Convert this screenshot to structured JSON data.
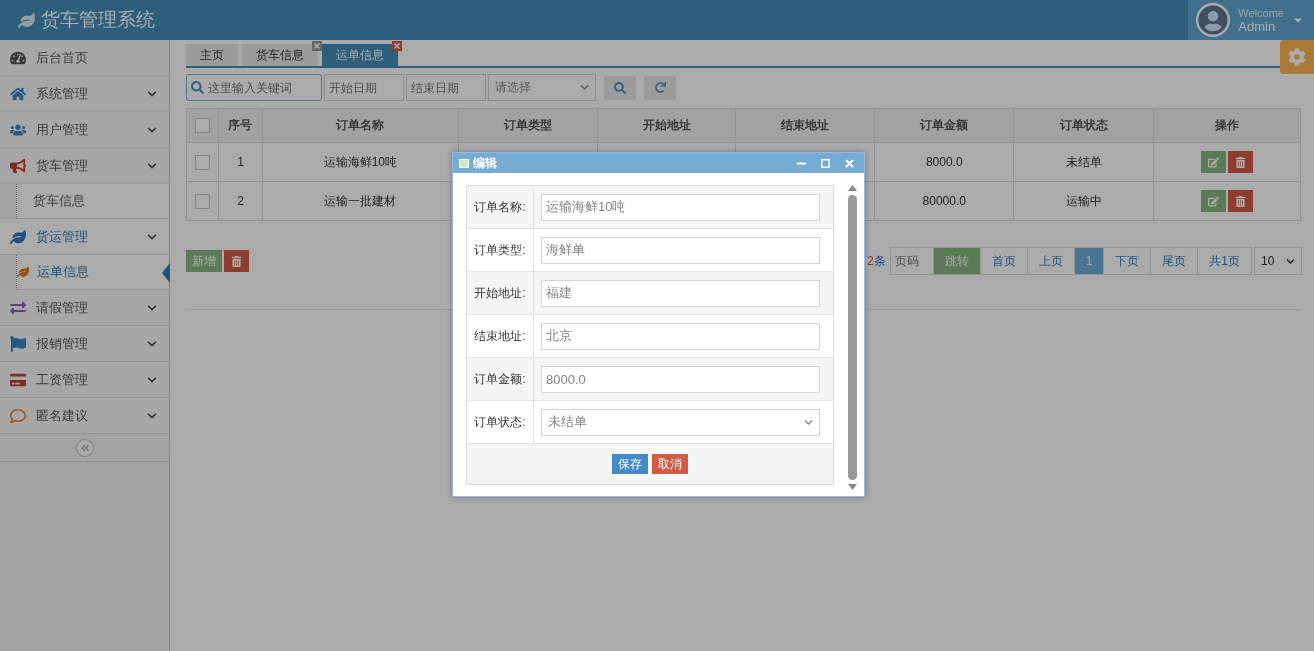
{
  "header": {
    "title": "货车管理系统",
    "welcome": "Welcome",
    "user": "Admin"
  },
  "sidebar": {
    "items": [
      {
        "kind": "link",
        "label": "后台首页",
        "selected": false
      },
      {
        "kind": "group",
        "label": "系统管理",
        "selected": false
      },
      {
        "kind": "group",
        "label": "用户管理",
        "selected": false
      },
      {
        "kind": "group",
        "label": "货车管理",
        "selected": false,
        "children": [
          {
            "label": "货车信息",
            "selected": false
          }
        ]
      },
      {
        "kind": "group",
        "label": "货运管理",
        "selected": true,
        "children": [
          {
            "label": "运单信息",
            "selected": true
          }
        ]
      },
      {
        "kind": "group",
        "label": "请假管理",
        "selected": false
      },
      {
        "kind": "group",
        "label": "报销管理",
        "selected": false
      },
      {
        "kind": "group",
        "label": "工资管理",
        "selected": false
      },
      {
        "kind": "group",
        "label": "匿名建议",
        "selected": false
      }
    ]
  },
  "tabs": [
    {
      "label": "主页",
      "selected": false,
      "closable": false
    },
    {
      "label": "货车信息",
      "selected": false,
      "closable": true
    },
    {
      "label": "运单信息",
      "selected": true,
      "closable": true
    }
  ],
  "toolbar": {
    "keyword": {
      "placeholder": "这里输入关键词"
    },
    "start_date": {
      "placeholder": "开始日期"
    },
    "end_date": {
      "placeholder": "结束日期"
    },
    "status": {
      "placeholder": "请选择"
    }
  },
  "table": {
    "all_checked": false,
    "columns": [
      "序号",
      "订单名称",
      "订单类型",
      "开始地址",
      "结束地址",
      "订单金额",
      "订单状态",
      "操作"
    ],
    "rows": [
      {
        "checked": false,
        "no": "1",
        "name": "运输海鲜10吨",
        "amount": "8000.0",
        "status": "未结单"
      },
      {
        "checked": false,
        "no": "2",
        "name": "运输一批建材",
        "amount": "80000.0",
        "status": "运输中"
      }
    ]
  },
  "actions": {
    "add": "新增"
  },
  "pagination": {
    "total_count": "2",
    "total_unit": "条",
    "page_placeholder": "页码",
    "jump": "跳转",
    "first": "首页",
    "prev": "上页",
    "pages": [
      {
        "label": "1",
        "selected": true
      }
    ],
    "next": "下页",
    "last": "尾页",
    "total_pages": "共1页",
    "page_size": "10"
  },
  "dialog": {
    "title": "编辑",
    "fields": [
      {
        "kind": "text",
        "label": "订单名称:",
        "value": "运输海鲜10吨"
      },
      {
        "kind": "text",
        "label": "订单类型:",
        "value": "海鲜单"
      },
      {
        "kind": "text",
        "label": "开始地址:",
        "value": "福建"
      },
      {
        "kind": "text",
        "label": "结束地址:",
        "value": "北京"
      },
      {
        "kind": "text",
        "label": "订单金额:",
        "value": "8000.0"
      },
      {
        "kind": "select",
        "label": "订单状态:",
        "value": "未结单"
      }
    ],
    "buttons": [
      {
        "kind": "primary",
        "label": "保存"
      },
      {
        "kind": "danger",
        "label": "取消"
      }
    ]
  }
}
